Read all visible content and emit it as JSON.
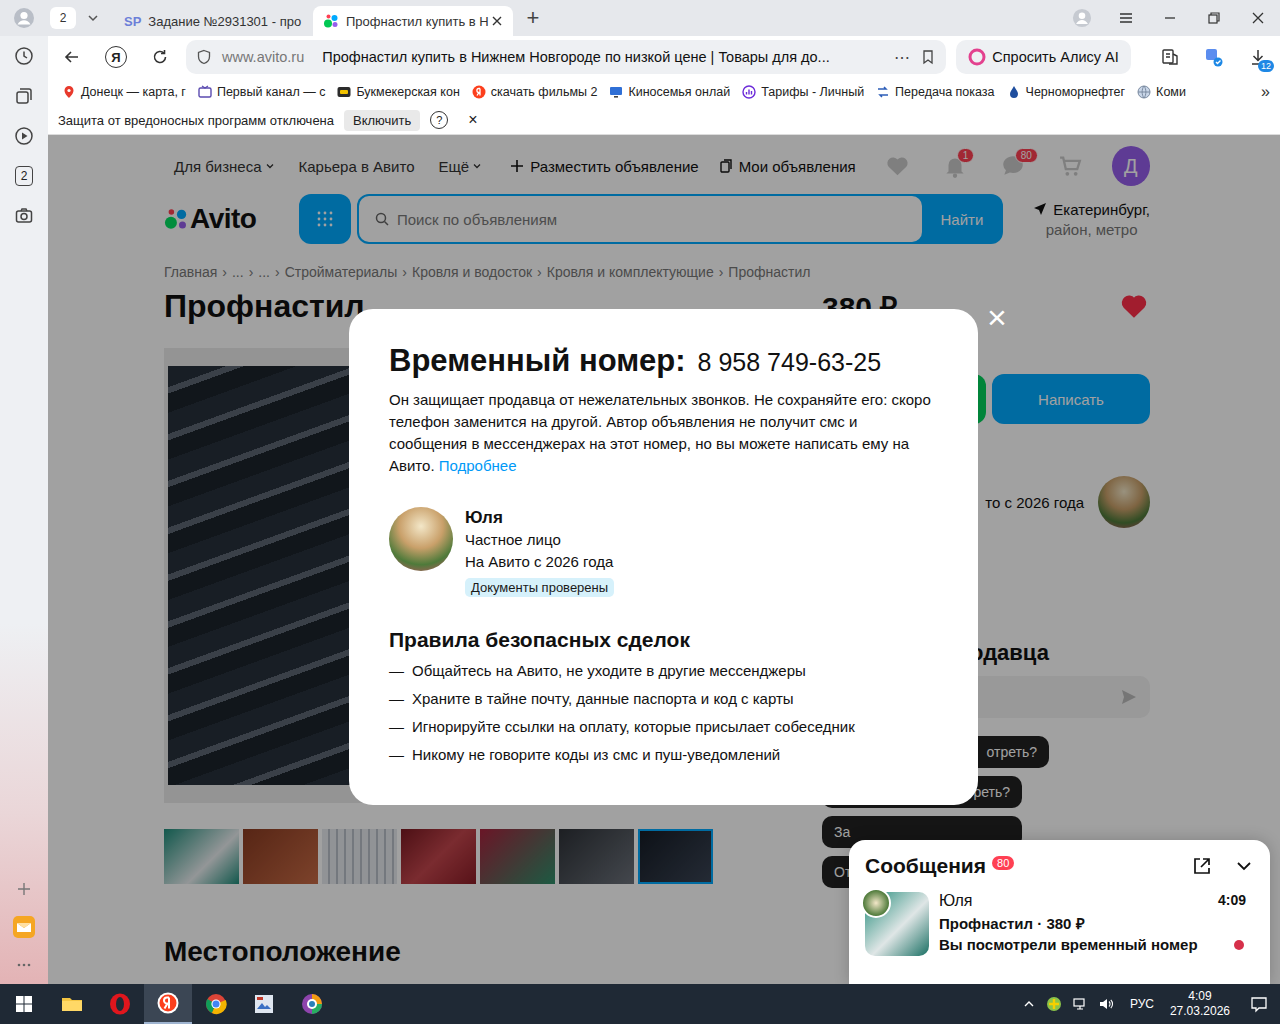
{
  "browser": {
    "tab_count": "2",
    "tabs": [
      {
        "label": "Задание №2931301 - про",
        "favicon": "SP",
        "selected": false
      },
      {
        "label": "Профнастил купить в Н",
        "favicon": "",
        "selected": true
      }
    ],
    "new_tab": "+",
    "yandex_button": "Я",
    "address": {
      "host": "www.avito.ru",
      "title": "Профнастил купить в Нижнем Новгороде по низкой цене | Товары для до...",
      "more": "⋯"
    },
    "alice": "Спросить Алису AI",
    "downloads_badge": "12",
    "bookmarks": [
      {
        "label": "Донецк — карта, г",
        "icon": "pin"
      },
      {
        "label": "Первый канал — с",
        "icon": "tv"
      },
      {
        "label": "Букмекерская кон",
        "icon": "bet"
      },
      {
        "label": "скачать фильмы 2",
        "icon": "yandex"
      },
      {
        "label": "Киносемья онлай",
        "icon": "monitor"
      },
      {
        "label": "Тарифы - Личный",
        "icon": "chart"
      },
      {
        "label": "Передача показа",
        "icon": "transfer"
      },
      {
        "label": "Черноморнефтег",
        "icon": "drop"
      },
      {
        "label": "Коми",
        "icon": "globe"
      }
    ],
    "bookmarks_more": "»",
    "info_bar": {
      "text": "Защита от вредоносных программ отключена",
      "button": "Включить",
      "help": "?",
      "close": "×"
    },
    "sidebar_tab_count": "2"
  },
  "page": {
    "header_links": [
      {
        "label": "Для бизнеса",
        "dropdown": true
      },
      {
        "label": "Карьера в Авито",
        "dropdown": false
      },
      {
        "label": "Ещё",
        "dropdown": true
      }
    ],
    "post_ad": "Разместить объявление",
    "my_ads": "Мои объявления",
    "notifications_badge": "1",
    "messages_badge": "80",
    "avatar": "Д",
    "logo": "Avito",
    "search": {
      "placeholder": "Поиск по объявлениям",
      "button": "Найти"
    },
    "location": [
      "Екатеринбург,",
      "район, метро"
    ],
    "breadcrumbs": [
      "Главная",
      "...",
      "...",
      "Стройматериалы",
      "Кровля и водосток",
      "Кровля и комплектующие",
      "Профнастил"
    ],
    "breadcrumb_sep": "›",
    "title": "Профнастил",
    "price": "380 ₽",
    "favorite": true,
    "write_button": "Написать",
    "seller_since": "то с 2026 года",
    "ask_heading": "одавца",
    "quick_replies": [
      "отреть?",
      "Когда можно посмотреть?",
      "За",
      "От"
    ],
    "thumbnails": [
      {
        "selected": false
      },
      {
        "selected": false
      },
      {
        "selected": false
      },
      {
        "selected": false
      },
      {
        "selected": false
      },
      {
        "selected": false
      },
      {
        "selected": true
      }
    ],
    "location_heading": "Местоположение"
  },
  "modal": {
    "close": "×",
    "title": "Временный номер:",
    "number": "8 958 749-63-25",
    "text": "Он защищает продавца от нежелательных звонков. Не сохраняйте его: скоро телефон заменится на другой. Автор объявления не получит смс и сообщения в мессенджерах на этот номер, но вы можете написать ему на Авито.",
    "link": "Подробнее",
    "seller": {
      "name": "Юля",
      "type": "Частное лицо",
      "since": "На Авито с 2026 года",
      "badge": "Документы проверены"
    },
    "rules_title": "Правила безопасных сделок",
    "rule_dash": "—",
    "rules": [
      "Общайтесь на Авито, не уходите в другие мессенджеры",
      "Храните в тайне почту, данные паспорта и код с карты",
      "Игнорируйте ссылки на оплату, которые присылает собеседник",
      "Никому не говорите коды из смс и пуш-уведомлений"
    ]
  },
  "messages": {
    "title": "Сообщения",
    "badge": "80",
    "items": [
      {
        "name": "Юля",
        "time": "4:09",
        "subject": "Профнастил · 380 ₽",
        "preview": "Вы посмотрели временный номер",
        "unread": true
      }
    ]
  },
  "taskbar": {
    "apps": [
      {
        "kind": "explorer",
        "selected": false
      },
      {
        "kind": "opera",
        "selected": false
      },
      {
        "kind": "yandex",
        "selected": true
      },
      {
        "kind": "chrome",
        "selected": false
      },
      {
        "kind": "app",
        "selected": false
      },
      {
        "kind": "browser",
        "selected": false
      }
    ],
    "lang": "РУС",
    "time": "4:09",
    "date": "27.03.2026"
  }
}
